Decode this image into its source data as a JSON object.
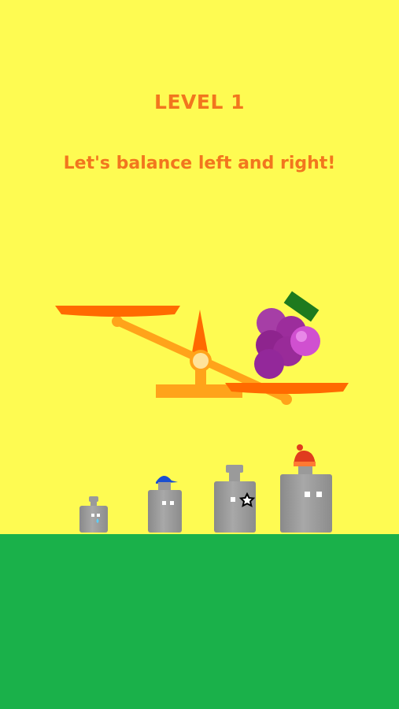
{
  "game": {
    "level_title": "LEVEL 1",
    "instruction": "Let's balance left and right!"
  },
  "scale": {
    "tilt": "right-side-down",
    "left_pan_contents": [],
    "right_pan_contents": [
      "grapes"
    ]
  },
  "weights": [
    {
      "name": "weight-smallest",
      "decoration": "teardrop"
    },
    {
      "name": "weight-small",
      "decoration": "blue-cap"
    },
    {
      "name": "weight-medium",
      "decoration": "star"
    },
    {
      "name": "weight-large",
      "decoration": "red-beanie"
    }
  ],
  "colors": {
    "background": "#fefb52",
    "ground": "#1ab14a",
    "text": "#f2761e",
    "pan": "#ff6a00",
    "beam": "#ffa31a",
    "grapes": "#9c2d9c",
    "weight": "#999999"
  }
}
